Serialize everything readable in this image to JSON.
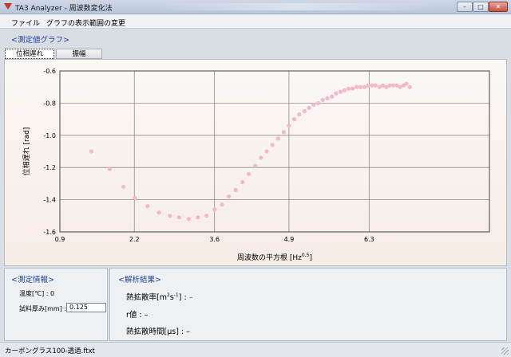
{
  "window": {
    "title": "TA3 Analyzer - 周波数変化法",
    "min_label": "–",
    "max_label": "□",
    "close_label": "✕"
  },
  "menu": {
    "items": [
      {
        "label": "ファイル"
      },
      {
        "label": "グラフの表示範囲の変更"
      }
    ]
  },
  "graph_section": {
    "title": "<測定値グラフ>",
    "tabs": [
      {
        "label": "位相遅れ",
        "active": true
      },
      {
        "label": "振幅",
        "active": false
      }
    ]
  },
  "chart_data": {
    "type": "scatter",
    "xlabel": "周波数の平方根 [Hz",
    "xlabel_sup": "0.5",
    "xlabel_end": "]",
    "ylabel": "位相遅れ [rad]",
    "xlim": [
      0.9,
      8.4
    ],
    "ylim": [
      -1.6,
      -0.6
    ],
    "xticks": [
      0.9,
      2.2,
      3.6,
      4.9,
      6.3
    ],
    "xtick_labels": [
      "0.9",
      "2.2",
      "3.6",
      "4.9",
      "6.3"
    ],
    "yticks": [
      -0.6,
      -0.8,
      -1.0,
      -1.2,
      -1.4,
      -1.6
    ],
    "ytick_labels": [
      "-0.6",
      "-0.8",
      "-1.0",
      "-1.2",
      "-1.4",
      "-1.6"
    ],
    "grid": true,
    "point_color": "#f4b8c8",
    "series": [
      {
        "x": [
          1.45,
          1.77,
          2.01,
          2.21,
          2.43,
          2.63,
          2.82,
          2.98,
          3.15,
          3.31,
          3.46,
          3.6,
          3.73,
          3.85,
          3.97,
          4.09,
          4.2,
          4.31,
          4.41,
          4.51,
          4.61,
          4.71,
          4.81,
          4.9,
          4.99,
          5.08,
          5.17,
          5.25,
          5.33,
          5.41,
          5.49,
          5.57,
          5.65,
          5.72,
          5.8,
          5.87,
          5.94,
          6.01,
          6.08,
          6.15,
          6.22,
          6.28,
          6.35,
          6.41,
          6.48,
          6.54,
          6.6,
          6.66,
          6.72,
          6.78,
          6.84,
          6.9,
          6.95,
          7.01
        ],
        "y": [
          -1.1,
          -1.21,
          -1.32,
          -1.39,
          -1.44,
          -1.48,
          -1.5,
          -1.51,
          -1.52,
          -1.51,
          -1.5,
          -1.46,
          -1.43,
          -1.38,
          -1.34,
          -1.29,
          -1.24,
          -1.19,
          -1.14,
          -1.1,
          -1.06,
          -1.02,
          -0.98,
          -0.94,
          -0.9,
          -0.87,
          -0.85,
          -0.83,
          -0.81,
          -0.8,
          -0.78,
          -0.77,
          -0.76,
          -0.74,
          -0.73,
          -0.72,
          -0.71,
          -0.71,
          -0.7,
          -0.7,
          -0.7,
          -0.69,
          -0.69,
          -0.69,
          -0.7,
          -0.69,
          -0.7,
          -0.69,
          -0.69,
          -0.69,
          -0.7,
          -0.69,
          -0.68,
          -0.7
        ]
      }
    ]
  },
  "measurement_info": {
    "title": "<測定情報>",
    "temperature_label": "温度[℃] :",
    "temperature_value": "0",
    "thickness_label": "試料厚み[mm] :",
    "thickness_value": "0.125"
  },
  "results": {
    "title": "<解析結果>",
    "diffusivity_label": "熱拡散率[m",
    "diffusivity_sup1": "2",
    "diffusivity_mid": "s",
    "diffusivity_sup2": "-1",
    "diffusivity_end": "] :",
    "diffusivity_value": "–",
    "r_label": "r値 :",
    "r_value": "–",
    "time_label": "熱拡散時間[μs] :",
    "time_value": "–"
  },
  "status": {
    "file": "カーボングラス100-透過.ftxt"
  }
}
